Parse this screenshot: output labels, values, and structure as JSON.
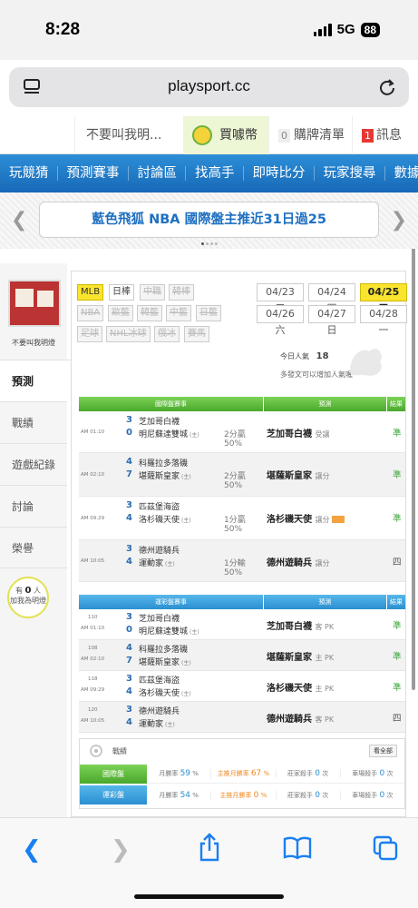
{
  "status": {
    "time": "8:28",
    "network": "5G",
    "battery": "88"
  },
  "browser": {
    "url": "playsport.cc"
  },
  "topbar": {
    "username": "不要叫我明...",
    "coin_label": "買噱幣",
    "cart_count": "0",
    "cart_label": "購牌清單",
    "msg_count": "1",
    "msg_label": "訊息"
  },
  "nav": [
    "玩競猜",
    "預測賽事",
    "討論區",
    "找高手",
    "即時比分",
    "玩家搜尋",
    "數據"
  ],
  "banner": {
    "text": "藍色飛狐 NBA 國際盤主推近31日過25"
  },
  "sidebar": {
    "username": "不要叫我明燈",
    "menu": [
      "預測",
      "戰績",
      "遊戲紀錄",
      "討論",
      "榮譽"
    ],
    "bulb_prefix": "有",
    "bulb_count": "0",
    "bulb_unit": "人",
    "bulb_text": "加我為明燈"
  },
  "leagues": {
    "row1": [
      "MLB",
      "日棒",
      "中職",
      "韓棒"
    ],
    "row2": [
      "NBA",
      "歐籃",
      "韓籃",
      "中籃",
      "日籃"
    ],
    "row3": [
      "足球",
      "NHL冰球",
      "俄冰",
      "賽馬"
    ]
  },
  "dates": [
    "04/23 三",
    "04/24 四",
    "04/25 五",
    "04/26 六",
    "04/27 日",
    "04/28 一"
  ],
  "popularity": {
    "label": "今日人氣",
    "value": "18",
    "note": "多發文可以增加人氣喔～"
  },
  "intl": {
    "headers": [
      "國際盤賽事",
      "預測",
      "結果"
    ],
    "games": [
      {
        "time": "AM 01:10",
        "s1": "3",
        "s2": "0",
        "t1": "芝加哥白襪",
        "t2": "明尼蘇達雙城",
        "h": "(主)",
        "line1": "2分贏",
        "line2": "50%",
        "pick": "芝加哥白襪",
        "pick_note": "受讓",
        "result": "準"
      },
      {
        "time": "AM 02:10",
        "s1": "4",
        "s2": "7",
        "t1": "科羅拉多落磯",
        "t2": "堪薩斯皇家",
        "h": "(主)",
        "line1": "2分贏",
        "line2": "50%",
        "pick": "堪薩斯皇家",
        "pick_note": "讓分",
        "result": "準"
      },
      {
        "time": "AM 09:29",
        "s1": "3",
        "s2": "4",
        "t1": "匹茲堡海盜",
        "t2": "洛杉磯天使",
        "h": "(主)",
        "line1": "1分贏",
        "line2": "50%",
        "pick": "洛杉磯天使",
        "pick_note": "讓分",
        "result": "準"
      },
      {
        "time": "AM 10:05",
        "s1": "3",
        "s2": "4",
        "t1": "德州遊騎兵",
        "t2": "運動家",
        "h": "(主)",
        "line1": "1分輸",
        "line2": "50%",
        "pick": "德州遊騎兵",
        "pick_note": "讓分",
        "result": "四"
      }
    ]
  },
  "lottery": {
    "headers": [
      "運彩盤賽事",
      "預測",
      "結果"
    ],
    "games": [
      {
        "num": "110",
        "time": "AM 01:10",
        "s1": "3",
        "s2": "0",
        "t1": "芝加哥白襪",
        "t2": "明尼蘇達雙城",
        "h": "(主)",
        "pick": "芝加哥白襪",
        "pick_note": "客 PK",
        "result": "準"
      },
      {
        "num": "108",
        "time": "AM 02:10",
        "s1": "4",
        "s2": "7",
        "t1": "科羅拉多落磯",
        "t2": "堪薩斯皇家",
        "h": "(主)",
        "pick": "堪薩斯皇家",
        "pick_note": "主 PK",
        "result": "準"
      },
      {
        "num": "118",
        "time": "AM 09:29",
        "s1": "3",
        "s2": "4",
        "t1": "匹茲堡海盜",
        "t2": "洛杉磯天使",
        "h": "(主)",
        "pick": "洛杉磯天使",
        "pick_note": "主 PK",
        "result": "準"
      },
      {
        "num": "120",
        "time": "AM 10:05",
        "s1": "3",
        "s2": "4",
        "t1": "德州遊騎兵",
        "t2": "運動家",
        "h": "(主)",
        "pick": "德州遊騎兵",
        "pick_note": "客 PK",
        "result": "四"
      }
    ]
  },
  "record": {
    "title": "戰績",
    "all_btn": "看全部",
    "intl": {
      "label": "國際盤",
      "month_rate_label": "月勝率",
      "month_rate": "59",
      "main_rate_label": "主推月勝率",
      "main_rate": "67",
      "banker_label": "莊家殺手",
      "banker": "0",
      "lottery_label": "車場殺手",
      "lottery": "0",
      "pct": "%",
      "unit": "次"
    },
    "lot": {
      "label": "運彩盤",
      "month_rate_label": "月勝率",
      "month_rate": "54",
      "main_rate_label": "主推月勝率",
      "main_rate": "0",
      "banker_label": "莊家殺手",
      "banker": "0",
      "lottery_label": "車場殺手",
      "lottery": "0",
      "pct": "%",
      "unit": "次"
    }
  },
  "colors": {
    "nav": "#1f7cc8",
    "green": "#5bbb35",
    "blue": "#3aa0dd",
    "highlight": "#f9e42e"
  }
}
